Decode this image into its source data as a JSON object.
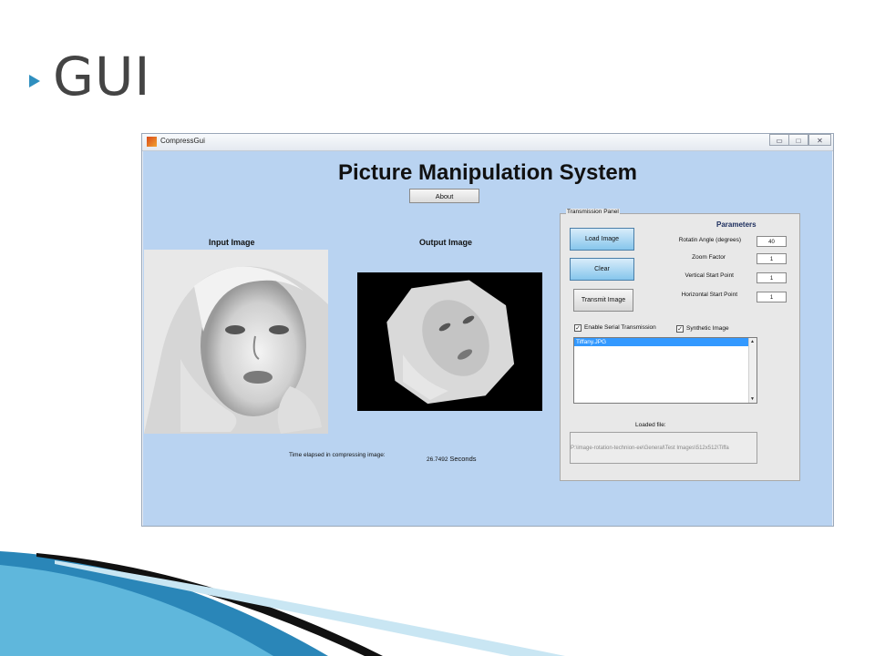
{
  "slide": {
    "title": "GUI"
  },
  "window": {
    "title": "CompressGui",
    "controls": {
      "minimize": "▭",
      "maximize": "□",
      "close": "✕"
    }
  },
  "main": {
    "title": "Picture Manipulation System",
    "about_label": "About",
    "input_label": "Input Image",
    "output_label": "Output Image",
    "time_label": "Time elapsed in compressing image:",
    "time_value": "26.7492",
    "time_unit": "Seconds"
  },
  "panel": {
    "title": "Transmission Panel",
    "load_label": "Load Image",
    "clear_label": "Clear",
    "transmit_label": "Transmit Image",
    "parameters_title": "Parameters",
    "params": [
      {
        "label": "Rotatin Angle (degrees)",
        "value": "40"
      },
      {
        "label": "Zoom Factor",
        "value": "1"
      },
      {
        "label": "Vertical Start Point",
        "value": "1"
      },
      {
        "label": "Horizontal Start Point",
        "value": "1"
      }
    ],
    "serial_label": "Enable Serial Transmission",
    "serial_checked": true,
    "synthetic_label": "Synthetic Image",
    "synthetic_checked": true,
    "list_items": [
      "Tiffany.JPG"
    ],
    "loaded_label": "Loaded file:",
    "loaded_path": "P:\\image-rotation-technion-ee\\General\\Test Images\\512x512\\Tiffa"
  },
  "colors": {
    "accent": "#2f8fbf",
    "client_bg": "#b9d3f1",
    "selected_item": "#3399ff"
  }
}
